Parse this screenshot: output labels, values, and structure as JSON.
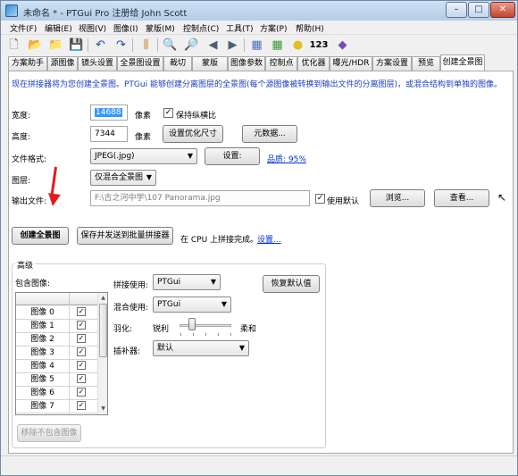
{
  "window": {
    "title": "未命名 * - PTGui Pro 注册给 John Scott",
    "controls": {
      "minimize": "–",
      "maximize": "□",
      "close": "✕"
    }
  },
  "menu": [
    "文件(F)",
    "编辑(E)",
    "视图(V)",
    "图像(I)",
    "蒙版(M)",
    "控制点(C)",
    "工具(T)",
    "方案(P)",
    "帮助(H)"
  ],
  "toolbar": {
    "icons": [
      {
        "name": "new-file-icon",
        "glyph": "🗋",
        "color": "#5c5c5c"
      },
      {
        "name": "open-folder-icon",
        "glyph": "📂",
        "color": "#d9a323"
      },
      {
        "name": "open-recent-icon",
        "glyph": "📁",
        "color": "#d9a323"
      },
      {
        "name": "save-icon",
        "glyph": "💾",
        "color": "#2f5fb2"
      },
      {
        "name": "undo-icon",
        "glyph": "↶",
        "color": "#1e4fa8"
      },
      {
        "name": "redo-icon",
        "glyph": "↷",
        "color": "#1e4fa8"
      },
      {
        "name": "control-points-icon",
        "glyph": "⫼",
        "color": "#c9822a"
      },
      {
        "name": "zoom-in-icon",
        "glyph": "🔍",
        "color": "#4d6b8a"
      },
      {
        "name": "zoom-out-icon",
        "glyph": "🔎",
        "color": "#4d6b8a"
      },
      {
        "name": "previous-icon",
        "glyph": "◀",
        "color": "#4f5f74"
      },
      {
        "name": "next-icon",
        "glyph": "▶",
        "color": "#4f5f74"
      },
      {
        "name": "images-icon",
        "glyph": "▦",
        "color": "#4a73b8"
      },
      {
        "name": "table-icon",
        "glyph": "▦",
        "color": "#3a9a3a"
      },
      {
        "name": "lightbulb-icon",
        "glyph": "●",
        "color": "#e0c020"
      },
      {
        "name": "numbering-icon",
        "glyph": "123",
        "color": "#000000"
      },
      {
        "name": "book-icon",
        "glyph": "◆",
        "color": "#7b4ab0"
      }
    ]
  },
  "tabs": [
    {
      "label": "方案助手",
      "active": false
    },
    {
      "label": "源图像",
      "active": false
    },
    {
      "label": "镜头设置",
      "active": false
    },
    {
      "label": "全景图设置",
      "active": false
    },
    {
      "label": "裁切",
      "active": false
    },
    {
      "label": "蒙版",
      "active": false
    },
    {
      "label": "图像参数",
      "active": false
    },
    {
      "label": "控制点",
      "active": false
    },
    {
      "label": "优化器",
      "active": false
    },
    {
      "label": "曝光/HDR",
      "active": false
    },
    {
      "label": "方案设置",
      "active": false
    },
    {
      "label": "预览",
      "active": false
    },
    {
      "label": "创建全景图",
      "active": true
    }
  ],
  "main": {
    "info": "现在拼接器将为您创建全景图。PTGui 能够创建分离图层的全景图(每个源图像被转换到输出文件的分离图层)，或混合结构到单独的图像。",
    "width_label": "宽度:",
    "width_value": "14688",
    "pixels_label_1": "像素",
    "keep_ratio_label": "保持纵横比",
    "keep_ratio_checked": "✓",
    "height_label": "高度:",
    "height_value": "7344",
    "pixels_label_2": "像素",
    "set_optimal_size": "设置优化尺寸",
    "metadata_button": "元数据...",
    "file_format_label": "文件格式:",
    "file_format_value": "JPEG(.jpg)",
    "settings_button": "设置:",
    "quality_link": "品质: 95%",
    "layer_label": "图层:",
    "layer_value": "仅混合全景图",
    "output_label": "输出文件:",
    "output_value": "F:\\古之河中学\\107 Panorama.jpg",
    "use_default_label": "使用默认",
    "use_default_checked": "✓",
    "browse_button": "浏览...",
    "view_button": "查看...",
    "create_button": "创建全景图",
    "save_batch_button": "保存并发送到批量拼接器",
    "cpu_status": "在 CPU 上拼接完成。",
    "settings_link": "设置..."
  },
  "advanced": {
    "title": "高级",
    "include_label": "包含图像:",
    "images": [
      {
        "name": "图像 0",
        "check": "✓"
      },
      {
        "name": "图像 1",
        "check": "✓"
      },
      {
        "name": "图像 2",
        "check": "✓"
      },
      {
        "name": "图像 3",
        "check": "✓"
      },
      {
        "name": "图像 4",
        "check": "✓"
      },
      {
        "name": "图像 5",
        "check": "✓"
      },
      {
        "name": "图像 6",
        "check": "✓"
      },
      {
        "name": "图像 7",
        "check": "✓"
      }
    ],
    "stitch_label": "拼接使用:",
    "stitch_value": "PTGui",
    "blend_label": "混合使用:",
    "blend_value": "PTGui",
    "feather_label": "羽化:",
    "feather_sharp": "锐利",
    "feather_soft": "柔和",
    "feather_level": 0.2,
    "interp_label": "插补器:",
    "interp_value": "默认",
    "restore_button": "恢复默认值",
    "remove_button": "移除不包含图像"
  },
  "colors": {
    "info_text": "#1a3ec2",
    "link": "#0033cc",
    "selection": "#3399ff",
    "annotation_arrow": "#e21b1b"
  }
}
